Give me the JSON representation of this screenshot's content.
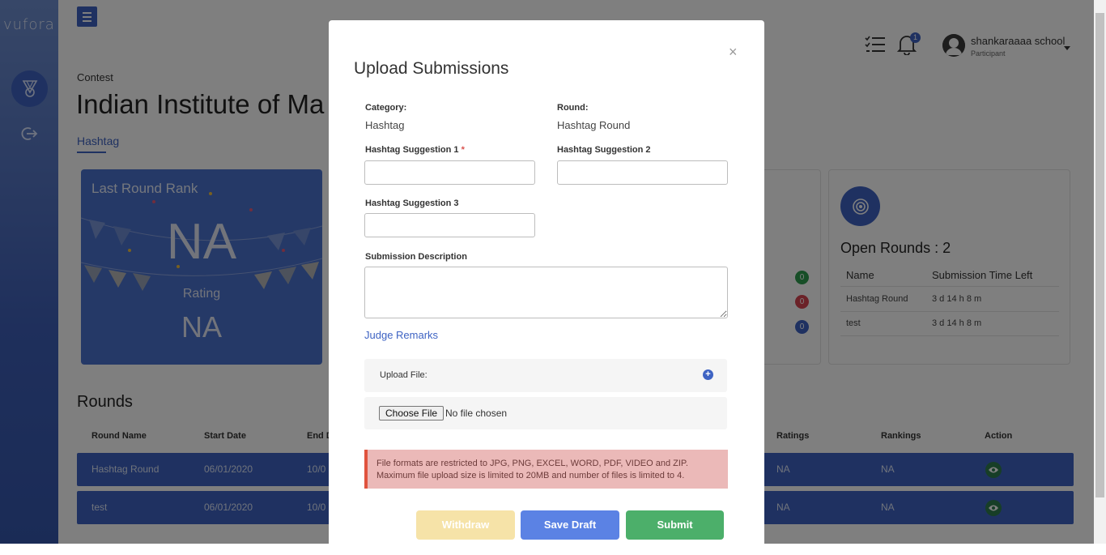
{
  "brand": {
    "logo": "vufora"
  },
  "header": {
    "notification_count": "1",
    "user_name": "shankaraaaa school",
    "user_role": "Participant"
  },
  "page": {
    "breadcrumb": "Contest",
    "title": "Indian Institute of Ma",
    "tab": "Hashtag"
  },
  "rank_card": {
    "title": "Last Round Rank",
    "rank_value": "NA",
    "rating_label": "Rating",
    "rating_value": "NA"
  },
  "stats": {
    "counts": [
      "0",
      "0",
      "0"
    ],
    "colors": [
      "#2e9c4f",
      "#d64550",
      "#3e63c3"
    ]
  },
  "open_rounds": {
    "title": "Open Rounds : 2",
    "headers": [
      "Name",
      "Submission Time Left"
    ],
    "rows": [
      {
        "name": "Hashtag Round",
        "time_left": "3 d 14 h 8 m"
      },
      {
        "name": "test",
        "time_left": "3 d 14 h 8 m"
      }
    ]
  },
  "rounds": {
    "title": "Rounds",
    "headers": [
      "Round Name",
      "Start Date",
      "End D",
      "Ratings",
      "Rankings",
      "Action"
    ],
    "rows": [
      {
        "name": "Hashtag Round",
        "start": "06/01/2020",
        "end": "10/0",
        "ratings": "NA",
        "rankings": "NA"
      },
      {
        "name": "test",
        "start": "06/01/2020",
        "end": "10/0",
        "ratings": "NA",
        "rankings": "NA"
      }
    ]
  },
  "modal": {
    "title": "Upload Submissions",
    "close": "×",
    "category_label": "Category:",
    "category_value": "Hashtag",
    "round_label": "Round:",
    "round_value": "Hashtag Round",
    "hashtag1_label": "Hashtag Suggestion 1",
    "required_mark": "*",
    "hashtag2_label": "Hashtag Suggestion 2",
    "hashtag3_label": "Hashtag Suggestion 3",
    "description_label": "Submission Description",
    "judge_remarks": "Judge Remarks",
    "upload_label": "Upload File:",
    "choose_file": "Choose File",
    "no_file": "No file chosen",
    "alert_line1": "File formats are restricted to JPG, PNG, EXCEL, WORD, PDF, VIDEO and ZIP.",
    "alert_line2": "Maximum file upload size is limited to 20MB and number of files is limited to 4.",
    "withdraw": "Withdraw",
    "save_draft": "Save Draft",
    "submit": "Submit"
  },
  "colors": {
    "primary": "#3e63c3",
    "withdraw": "#f6e3a8",
    "save_draft": "#5b82e4",
    "submit": "#4caf6a",
    "alert_bg": "#ebb9b8",
    "alert_border": "#e0533e"
  }
}
